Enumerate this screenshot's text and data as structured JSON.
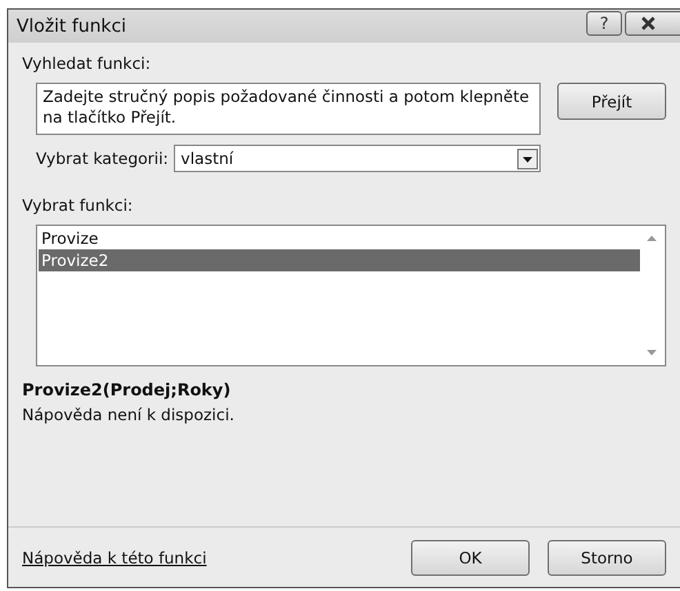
{
  "window": {
    "title": "Vložit funkci",
    "help_button": "?"
  },
  "search": {
    "label": "Vyhledat funkci:",
    "value": "Zadejte stručný popis požadované činnosti a potom klepněte na tlačítko Přejít.",
    "button": "Přejít"
  },
  "category": {
    "label": "Vybrat kategorii:",
    "value": "vlastní"
  },
  "functions": {
    "label": "Vybrat funkci:",
    "items": [
      {
        "name": "Provize",
        "selected": false
      },
      {
        "name": "Provize2",
        "selected": true
      }
    ]
  },
  "signature": "Provize2(Prodej;Roky)",
  "description": "Nápověda není k dispozici.",
  "help_link": "Nápověda k této funkci",
  "buttons": [
    "OK",
    "Storno"
  ]
}
